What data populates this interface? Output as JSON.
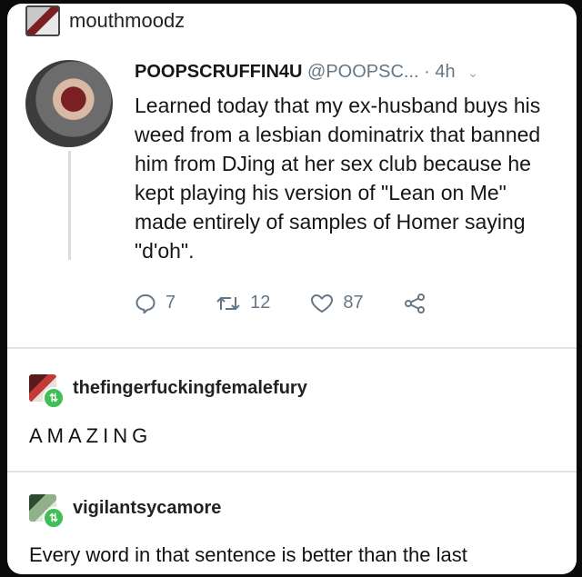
{
  "header": {
    "username": "mouthmoodz"
  },
  "tweet": {
    "display_name": "POOPSCRUFFIN4U",
    "handle": "@POOPSC...",
    "separator": "·",
    "time": "4h",
    "text": "Learned today that my ex-husband buys his weed from a lesbian dominatrix that banned him from DJing at her sex club because he kept playing his version of \"Lean on Me\" made entirely of samples of Homer saying \"d'oh\".",
    "replies": "7",
    "retweets": "12",
    "likes": "87"
  },
  "replies": [
    {
      "username": "thefingerfuckingfemalefury",
      "text": "AMAZING"
    },
    {
      "username": "vigilantsycamore",
      "text": "Every word in that sentence is better than the last"
    }
  ],
  "colors": {
    "reblog_badge": "#3fbf55",
    "twitter_gray": "#657786"
  }
}
